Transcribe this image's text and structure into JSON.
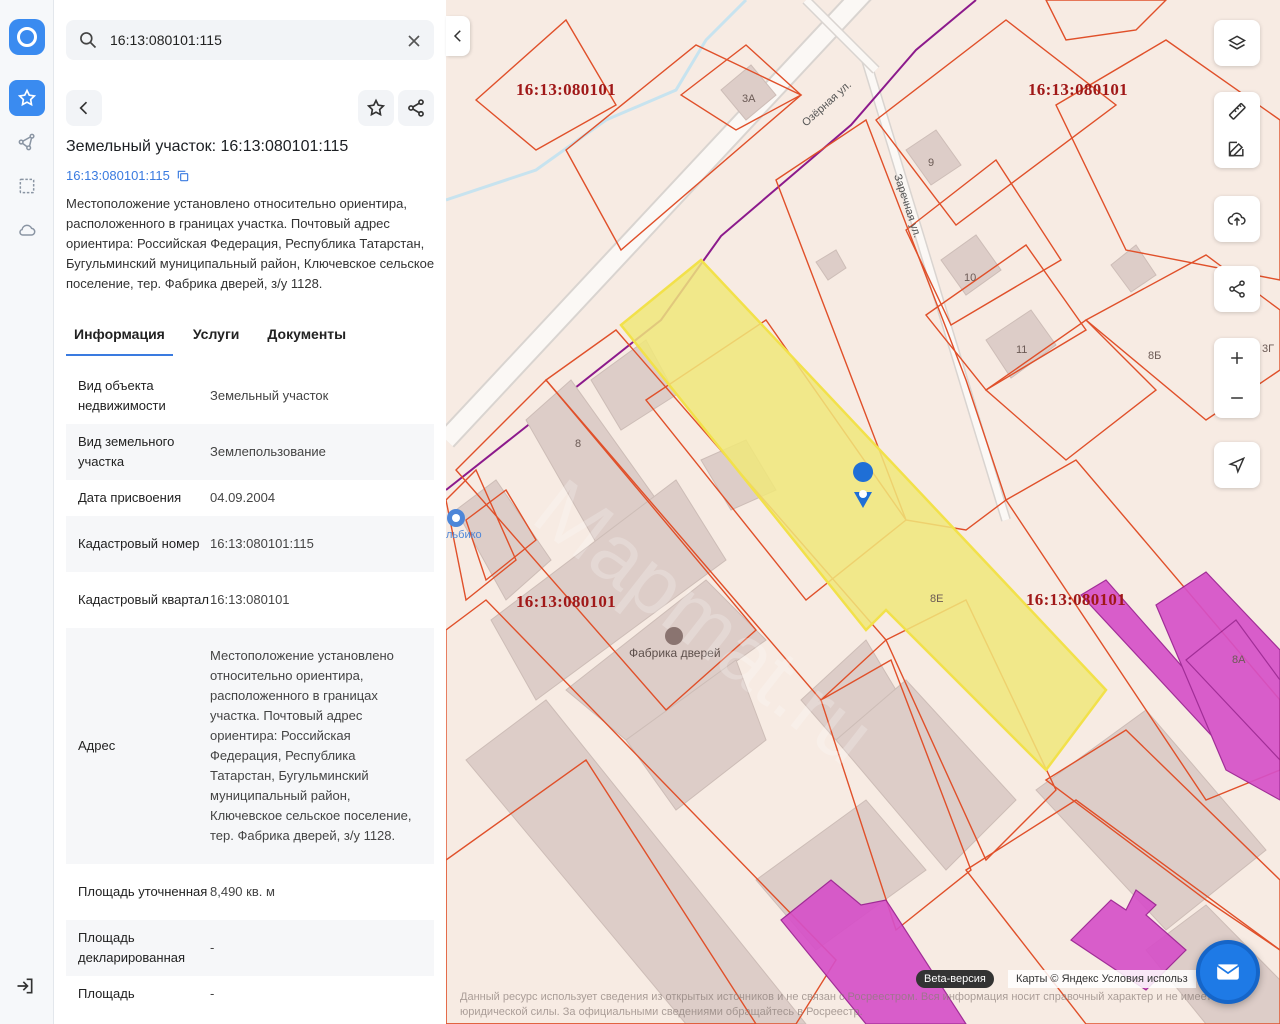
{
  "search": {
    "value": "16:13:080101:115",
    "placeholder": ""
  },
  "object": {
    "title": "Земельный участок: 16:13:080101:115",
    "cad_number_link": "16:13:080101:115",
    "description": "Местоположение установлено относительно ориентира, расположенного в границах участка. Почтовый адрес ориентира: Российская Федерация, Республика Татарстан, Бугульминский муниципальный район, Ключевское сельское поселение, тер. Фабрика дверей, з/у 1128."
  },
  "tabs": [
    {
      "label": "Информация",
      "active": true
    },
    {
      "label": "Услуги",
      "active": false
    },
    {
      "label": "Документы",
      "active": false
    }
  ],
  "info_table": [
    {
      "key": "Вид объекта недвижимости",
      "value": "Земельный участок"
    },
    {
      "key": "Вид земельного участка",
      "value": "Землепользование"
    },
    {
      "key": "Дата присвоения",
      "value": "04.09.2004"
    },
    {
      "key": "Кадастровый номер",
      "value": "16:13:080101:115"
    },
    {
      "key": "Кадастровый квартал",
      "value": "16:13:080101"
    },
    {
      "key": "Адрес",
      "value": "Местоположение установлено относительно ориентира, расположенного в границах участка. Почтовый адрес ориентира: Российская Федерация, Республика Татарстан, Бугульминский муниципальный район, Ключевское сельское поселение, тер. Фабрика дверей, з/у 1128."
    },
    {
      "key": "Площадь уточненная",
      "value": "8,490 кв. м"
    },
    {
      "key": "Площадь декларированная",
      "value": "-"
    },
    {
      "key": "Площадь",
      "value": "-"
    }
  ],
  "map": {
    "quarter_labels": [
      "16:13:080101",
      "16:13:080101",
      "16:13:080101",
      "16:13:080101"
    ],
    "house_numbers": [
      "3А",
      "9",
      "10",
      "11",
      "8Б",
      "8",
      "8Е",
      "8А",
      "3Г"
    ],
    "streets": [
      "Озёрная ул.",
      "Заречная ул."
    ],
    "poi": "Фабрика дверей",
    "poi_partial": "льбико",
    "watermark": "Mapmat.ru",
    "beta_label": "Beta-версия",
    "copyright": "Карты © Яндекс   Условия использ",
    "disclaimer": "Данный ресурс использует сведения из открытых источников и не связан с Росреестром. Вся информация носит справочный характер и не имеет юридической силы. За официальными сведениями обращайтесь в Росреестр."
  },
  "colors": {
    "accent": "#3a8bf0",
    "parcel_border": "#e0502a",
    "selected_fill": "#f0e87a",
    "quarter_label": "#a01818",
    "magenta_zone": "#d04fc8"
  }
}
